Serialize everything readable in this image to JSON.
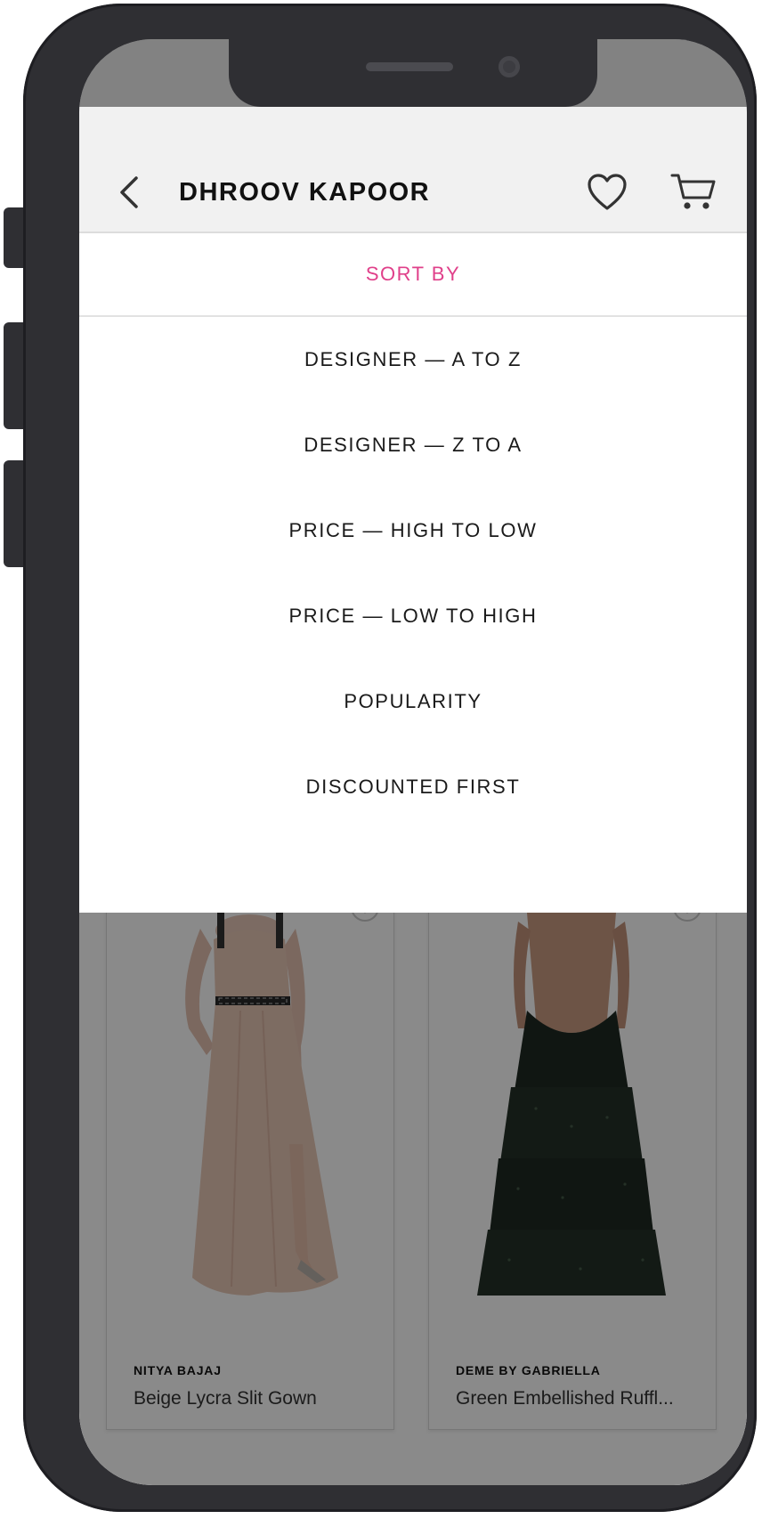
{
  "header": {
    "title": "DHROOV KAPOOR"
  },
  "sort": {
    "title": "SORT BY",
    "options": [
      "DESIGNER — A TO Z",
      "DESIGNER — Z TO A",
      "PRICE — HIGH TO LOW",
      "PRICE — LOW TO HIGH",
      "POPULARITY",
      "DISCOUNTED FIRST"
    ]
  },
  "products": [
    {
      "designer": "NITYA BAJAJ",
      "name": "Beige Lycra Slit Gown"
    },
    {
      "designer": "DEME BY GABRIELLA",
      "name": "Green Embellished Ruffl..."
    }
  ],
  "colors": {
    "accent": "#e0408a",
    "frame": "#2f2f33",
    "header_bg": "#f1f1f1"
  }
}
